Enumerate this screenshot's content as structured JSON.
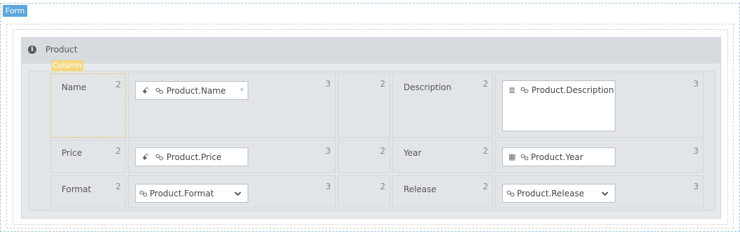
{
  "form": {
    "tag": "Form"
  },
  "panel": {
    "title": "Product",
    "info_icon": "i"
  },
  "column_tag": "Column",
  "rows": [
    {
      "label": "Name",
      "label_span": "2",
      "field": {
        "value": "Product.Name",
        "span": "3",
        "type_glyph": "ꗃ",
        "required": "*"
      },
      "spacer_span": "2",
      "label2": "Description",
      "label2_span": "2",
      "field2": {
        "value": "Product.Description",
        "span": "3",
        "type_glyph": "≣"
      }
    },
    {
      "label": "Price",
      "label_span": "2",
      "field": {
        "value": "Product.Price",
        "span": "3",
        "type_glyph": "ꗃ"
      },
      "spacer_span": "2",
      "label2": "Year",
      "label2_span": "2",
      "field2": {
        "value": "Product.Year",
        "span": "3",
        "type_glyph": "▦"
      }
    },
    {
      "label": "Format",
      "label_span": "2",
      "field": {
        "value": "Product.Format",
        "span": "3"
      },
      "spacer_span": "2",
      "label2": "Release",
      "label2_span": "2",
      "field2": {
        "value": "Product.Release",
        "span": "3"
      }
    }
  ],
  "icons": {
    "info": "info-icon",
    "link": "link-icon",
    "text_type": "text-type-icon",
    "multiline": "multiline-icon",
    "calendar": "calendar-icon",
    "chevron": "chevron-down-icon"
  },
  "colors": {
    "form_accent": "#5ea6dc",
    "column_accent": "#f5d77e",
    "panel_bg": "#e6e9ec"
  }
}
